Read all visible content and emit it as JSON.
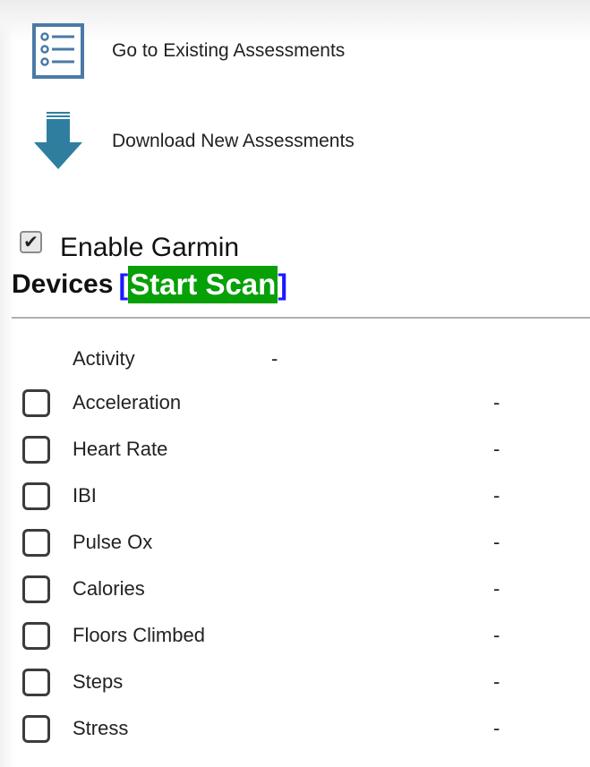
{
  "menu": {
    "existing_label": "Go to Existing Assessments",
    "download_label": "Download New Assessments"
  },
  "garmin": {
    "enable_label": "Enable Garmin",
    "enabled": true,
    "devices_label": "Devices",
    "bracket_open": "[",
    "bracket_close": "]",
    "scan_label": "Start Scan"
  },
  "activity": {
    "label": "Activity",
    "value": "-"
  },
  "sensors": [
    {
      "label": "Acceleration",
      "value": "-",
      "checked": false
    },
    {
      "label": "Heart Rate",
      "value": "-",
      "checked": false
    },
    {
      "label": "IBI",
      "value": "-",
      "checked": false
    },
    {
      "label": "Pulse Ox",
      "value": "-",
      "checked": false
    },
    {
      "label": "Calories",
      "value": "-",
      "checked": false
    },
    {
      "label": "Floors Climbed",
      "value": "-",
      "checked": false
    },
    {
      "label": "Steps",
      "value": "-",
      "checked": false
    },
    {
      "label": "Stress",
      "value": "-",
      "checked": false
    }
  ],
  "colors": {
    "icon_blue": "#4a7aa8",
    "download_arrow": "#2f7ea0",
    "scan_green": "#07a007",
    "bracket_blue": "#1a1aff"
  },
  "icons": {
    "existing": "list-icon",
    "download": "download-arrow-icon"
  }
}
